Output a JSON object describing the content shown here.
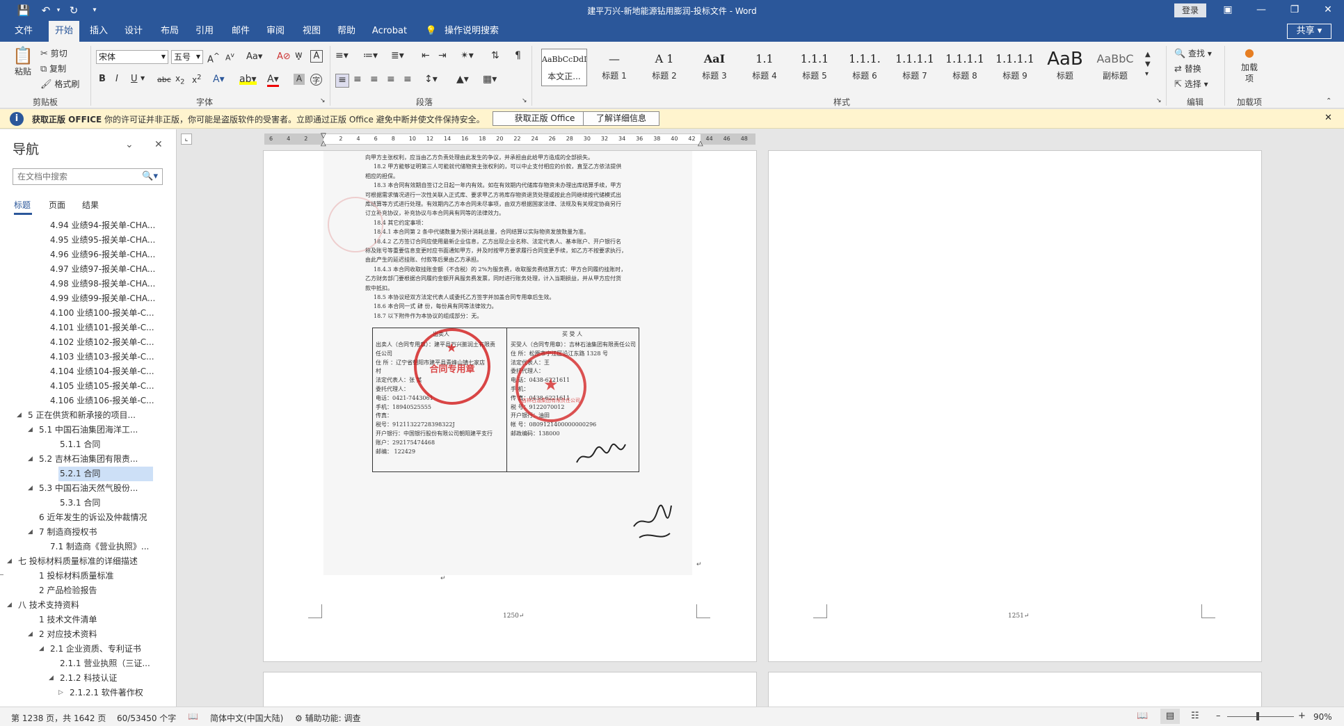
{
  "window": {
    "title": "建平万兴-新地能源钻用膨润-投标文件  -  Word",
    "login": "登录",
    "share": "共享"
  },
  "tabs": [
    "文件",
    "开始",
    "插入",
    "设计",
    "布局",
    "引用",
    "邮件",
    "审阅",
    "视图",
    "帮助",
    "Acrobat",
    "操作说明搜索"
  ],
  "ribbon": {
    "clipboard": {
      "paste": "粘贴",
      "cut": "剪切",
      "copy": "复制",
      "format_painter": "格式刷",
      "label": "剪贴板"
    },
    "font": {
      "name": "宋体",
      "size": "五号",
      "label": "字体"
    },
    "paragraph": {
      "label": "段落"
    },
    "styles": {
      "label": "样式",
      "items": [
        {
          "sample": "AaBbCcDdI",
          "name": "本文正..."
        },
        {
          "sample": "—",
          "name": "标题 1"
        },
        {
          "sample": "A 1",
          "name": "标题 2"
        },
        {
          "sample": "AaI",
          "name": "标题 3"
        },
        {
          "sample": "1.1",
          "name": "标题 4"
        },
        {
          "sample": "1.1.1",
          "name": "标题 5"
        },
        {
          "sample": "1.1.1.",
          "name": "标题 6"
        },
        {
          "sample": "1.1.1.1",
          "name": "标题 7"
        },
        {
          "sample": "1.1.1.1",
          "name": "标题 8"
        },
        {
          "sample": "1.1.1.1",
          "name": "标题 9"
        },
        {
          "sample": "1.1.1.1",
          "name": "标题"
        },
        {
          "sample": "AaB",
          "name": "副标题"
        },
        {
          "sample": "AaBbC",
          "name": "副标题"
        }
      ]
    },
    "editing": {
      "find": "查找",
      "replace": "替换",
      "select": "选择",
      "label": "编辑"
    },
    "addins": {
      "load": "加载项",
      "label": "加载项"
    }
  },
  "infobar": {
    "title": "获取正版 OFFICE",
    "message": "你的许可证并非正版，你可能是盗版软件的受害者。立即通过正版 Office 避免中断并使文件保持安全。",
    "btn_get": "获取正版 Office",
    "btn_learn": "了解详细信息"
  },
  "nav": {
    "title": "导航",
    "search_placeholder": "在文档中搜索",
    "tabs": [
      "标题",
      "页面",
      "结果"
    ],
    "items": [
      {
        "text": "4.94 业绩94-报关单-CHA...",
        "lvl": 4,
        "arrow": ""
      },
      {
        "text": "4.95 业绩95-报关单-CHA...",
        "lvl": 4,
        "arrow": ""
      },
      {
        "text": "4.96 业绩96-报关单-CHA...",
        "lvl": 4,
        "arrow": ""
      },
      {
        "text": "4.97 业绩97-报关单-CHA...",
        "lvl": 4,
        "arrow": ""
      },
      {
        "text": "4.98 业绩98-报关单-CHA...",
        "lvl": 4,
        "arrow": ""
      },
      {
        "text": "4.99 业绩99-报关单-CHA...",
        "lvl": 4,
        "arrow": ""
      },
      {
        "text": "4.100 业绩100-报关单-C...",
        "lvl": 4,
        "arrow": ""
      },
      {
        "text": "4.101 业绩101-报关单-C...",
        "lvl": 4,
        "arrow": ""
      },
      {
        "text": "4.102 业绩102-报关单-C...",
        "lvl": 4,
        "arrow": ""
      },
      {
        "text": "4.103 业绩103-报关单-C...",
        "lvl": 4,
        "arrow": ""
      },
      {
        "text": "4.104 业绩104-报关单-C...",
        "lvl": 4,
        "arrow": ""
      },
      {
        "text": "4.105 业绩105-报关单-C...",
        "lvl": 4,
        "arrow": ""
      },
      {
        "text": "4.106 业绩106-报关单-C...",
        "lvl": 4,
        "arrow": ""
      },
      {
        "text": "5 正在供货和新承接的项目...",
        "lvl": 2,
        "arrow": "◢"
      },
      {
        "text": "5.1 中国石油集团海洋工...",
        "lvl": 3,
        "arrow": "◢"
      },
      {
        "text": "5.1.1 合同",
        "lvl": 5,
        "arrow": ""
      },
      {
        "text": "5.2 吉林石油集团有限责...",
        "lvl": 3,
        "arrow": "◢"
      },
      {
        "text": "5.2.1 合同",
        "lvl": 5,
        "arrow": "",
        "sel": true
      },
      {
        "text": "5.3 中国石油天然气股份...",
        "lvl": 3,
        "arrow": "◢"
      },
      {
        "text": "5.3.1 合同",
        "lvl": 5,
        "arrow": ""
      },
      {
        "text": "6 近年发生的诉讼及仲裁情况",
        "lvl": 3,
        "arrow": ""
      },
      {
        "text": "7 制造商授权书",
        "lvl": 3,
        "arrow": "◢"
      },
      {
        "text": "7.1 制造商《营业执照》...",
        "lvl": 4,
        "arrow": ""
      },
      {
        "text": "七 投标材料质量标准的详细描述",
        "lvl": 1,
        "arrow": "◢"
      },
      {
        "text": "1 投标材料质量标准",
        "lvl": 3,
        "arrow": ""
      },
      {
        "text": "2 产品检验报告",
        "lvl": 3,
        "arrow": ""
      },
      {
        "text": "八 技术支持资料",
        "lvl": 1,
        "arrow": "◢"
      },
      {
        "text": "1 技术文件清单",
        "lvl": 3,
        "arrow": ""
      },
      {
        "text": "2 对应技术资料",
        "lvl": 3,
        "arrow": "◢"
      },
      {
        "text": "2.1 企业资质、专利证书",
        "lvl": 4,
        "arrow": "◢"
      },
      {
        "text": "2.1.1 营业执照（三证...",
        "lvl": 5,
        "arrow": ""
      },
      {
        "text": "2.1.2 科技认证",
        "lvl": 5,
        "arrow": "◢"
      },
      {
        "text": "2.1.2.1 软件著作权",
        "lvl": 6,
        "arrow": "▷"
      }
    ]
  },
  "ruler": [
    "6",
    "4",
    "2",
    "",
    "2",
    "4",
    "6",
    "8",
    "10",
    "12",
    "14",
    "16",
    "18",
    "20",
    "22",
    "24",
    "26",
    "28",
    "30",
    "32",
    "34",
    "36",
    "38",
    "40",
    "42",
    "44",
    "46",
    "48"
  ],
  "document": {
    "page1_number": "1250↵",
    "page2_number": "1251↵",
    "lines": [
      "向甲方主张权利，应当由乙方负责处理由此发生的争议，并承担由此给甲方造成的全部损失。",
      "18.2 甲方能够证明第三人可能就代储物资主张权利的，可以中止支付相应的价款，直至乙方依法提供",
      "相应的担保。",
      "18.3 本合同有效期自签订之日起一年内有效。如在有效期内代储库存物资未办理出库结算手续，甲方",
      "可根据需求情况进行一次性关联入正式库、要求甲乙方将库存物资退货处理或按此合同继续按代储模式出",
      "库结算等方式进行处理。有效期内乙方本合同未尽事项，由双方根据国家法律、法规及有关规定协商另行",
      "订立补充协议，补充协议与本合同具有同等的法律效力。",
      "18.4 其它约定事项：",
      "18.4.1 本合同第 2 条中代储数量为预计消耗总量，合同结算以实际物资发放数量为准。",
      "18.4.2 乙方签订合同应使用最新企业信息，乙方出现企业名称、法定代表人、基本账户、开户银行名",
      "称及账号等重要信息变更时应书面通知甲方，并及时按甲方要求履行合同变更手续，如乙方不按要求执行，",
      "由此产生的延迟挂账、付款等后果由乙方承担。",
      "18.4.3 本合同收取挂账金额（不含税）的 2%为服务费，收取服务费结算方式：甲方合同履约挂账时，",
      "乙方财务部门要根据合同履约金额开具服务费发票，同时进行账务处理，计入当期损益，并从甲方应付货",
      "款中抵扣。",
      "18.5 本协议经双方法定代表人或委托乙方签字并加盖合同专用章后生效。",
      "18.6 本合同一式 肆 份，每份具有同等法律效力。",
      "18.7 以下附件作为本协议的组成部分：无。"
    ],
    "seller_title": "出卖人",
    "buyer_title": "买 受 人",
    "seller_lines": [
      "出卖人（合同专用章）：建平县万兴膨润土有限责",
      "任公司",
      "住  所  ：辽宁省朝阳市建平县青峰山镇七家店",
      "村",
      "法定代表人：张 某",
      "委托代理人：",
      "电话：0421-7443061",
      "手机：18940525555",
      "传真：",
      "税号：91211322728398322J",
      "开户银行：中国银行股份有限公司朝阳建平支行",
      "账户：292175474468",
      "邮编：  122429"
    ],
    "buyer_lines": [
      "买受人（合同专用章）：吉林石油集团有限责任公司",
      "住  所：松原市宁江区沿江东路 1328 号",
      "法定代表人：王",
      "委托代理人：",
      "电      话：0438-6221611",
      "手      机：",
      "传      真：0438-6221611",
      "税      号：9122070012",
      "开户银行：油田",
      "帐      号：0809121400000000296",
      "邮政编码：138000"
    ],
    "stamp1": "合同专用章",
    "stamp2": "吉林石油集团有限责任公司"
  },
  "status": {
    "page": "第 1238 页，共 1642 页",
    "words": "60/53450 个字",
    "lang": "简体中文(中国大陆)",
    "access": "辅助功能: 调查",
    "zoom": "90%"
  }
}
